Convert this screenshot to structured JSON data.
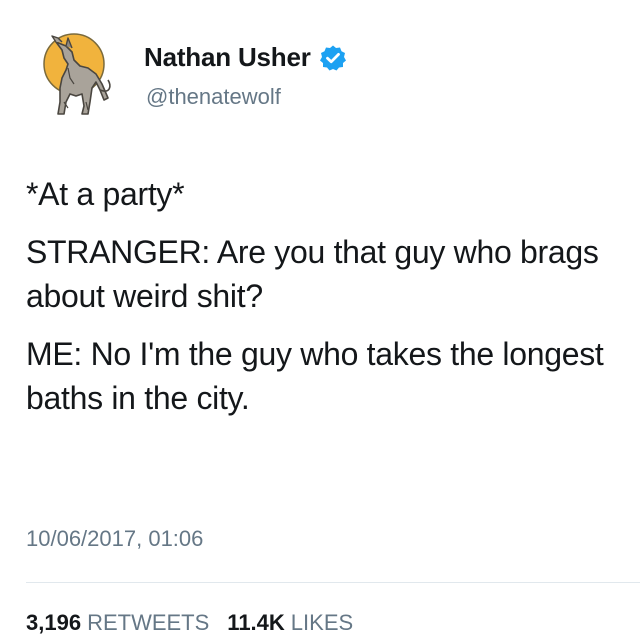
{
  "author": {
    "display_name": "Nathan Usher",
    "handle": "@thenatewolf",
    "verified_icon": "verified-badge-icon",
    "avatar_icon": "howling-wolf-icon",
    "accent_color": "#1da1f2"
  },
  "tweet": {
    "lines": [
      "*At a party*",
      "STRANGER: Are you that guy who brags about weird shit?",
      "ME: No I'm the guy who takes the longest baths in the city."
    ],
    "timestamp": "10/06/2017, 01:06"
  },
  "stats": {
    "retweets_count": "3,196",
    "retweets_label": "RETWEETS",
    "likes_count": "11.4K",
    "likes_label": "LIKES"
  }
}
